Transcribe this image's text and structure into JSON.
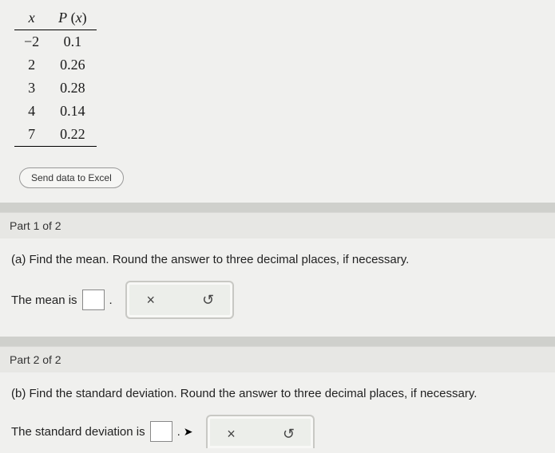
{
  "table": {
    "head_x": "x",
    "head_px": "P(x)",
    "rows": [
      {
        "x": "−2",
        "px": "0.1"
      },
      {
        "x": "2",
        "px": "0.26"
      },
      {
        "x": "3",
        "px": "0.28"
      },
      {
        "x": "4",
        "px": "0.14"
      },
      {
        "x": "7",
        "px": "0.22"
      }
    ]
  },
  "buttons": {
    "excel": "Send data to Excel"
  },
  "part1": {
    "header": "Part 1 of 2",
    "question": "(a) Find the mean. Round the answer to three decimal places, if necessary.",
    "answer_prefix": "The mean is",
    "answer_suffix": "."
  },
  "part2": {
    "header": "Part 2 of 2",
    "question": "(b) Find the standard deviation. Round the answer to three decimal places, if necessary.",
    "answer_prefix": "The standard deviation is",
    "answer_suffix": "."
  },
  "tools": {
    "clear": "×",
    "reset": "↺"
  },
  "chart_data": {
    "type": "table",
    "columns": [
      "x",
      "P(x)"
    ],
    "rows": [
      [
        -2,
        0.1
      ],
      [
        2,
        0.26
      ],
      [
        3,
        0.28
      ],
      [
        4,
        0.14
      ],
      [
        7,
        0.22
      ]
    ]
  }
}
